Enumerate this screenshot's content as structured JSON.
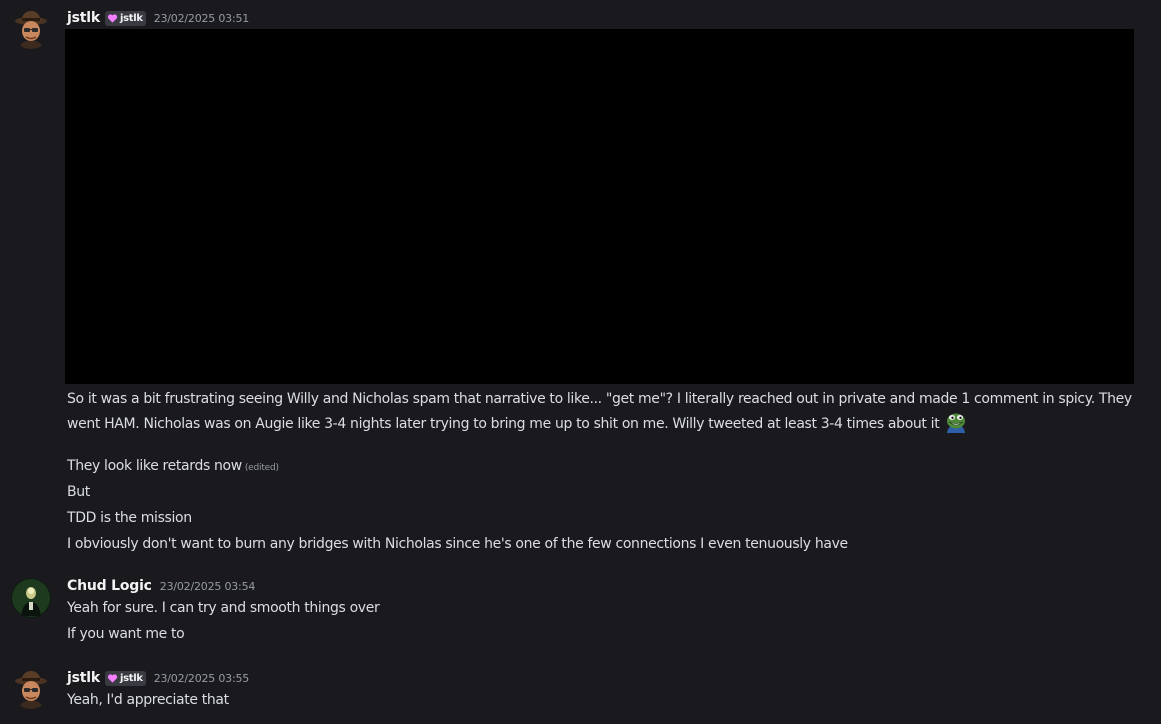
{
  "messages": [
    {
      "author": "jstlk",
      "role_tag": "jstlk",
      "timestamp": "23/02/2025 03:51",
      "attachment": "black-image",
      "lines": [
        "So it was a bit frustrating seeing Willy and Nicholas spam that narrative to like... \"get me\"? I literally reached out in private and made 1 comment in spicy. They went HAM. Nicholas was on Augie like 3-4 nights later trying to bring me up to shit on me. Willy tweeted at least 3-4 times about it",
        "They look like retards now",
        "But",
        "TDD is the mission",
        "I obviously don't want to burn any bridges with Nicholas since he's one of the few connections I even tenuously have"
      ],
      "edited_label": "(edited)",
      "emoji": "pepe-grin-emoji"
    },
    {
      "author": "Chud Logic",
      "timestamp": "23/02/2025 03:54",
      "lines": [
        "Yeah for sure. I can try and smooth things over",
        "If you want me to"
      ]
    },
    {
      "author": "jstlk",
      "role_tag": "jstlk",
      "timestamp": "23/02/2025 03:55",
      "lines": [
        "Yeah, I'd appreciate that"
      ]
    }
  ],
  "colors": {
    "background": "#1a1a1e",
    "text": "#dbdee1",
    "username": "#f2f3f5",
    "timestamp": "#949ba4",
    "role_tag_bg": "#3a3b42",
    "role_heart": "#f47fff"
  },
  "icons": {
    "role_tag_icon": "heart-icon",
    "avatar_1": "cowboy-avatar",
    "avatar_2": "dark-portrait-avatar"
  }
}
